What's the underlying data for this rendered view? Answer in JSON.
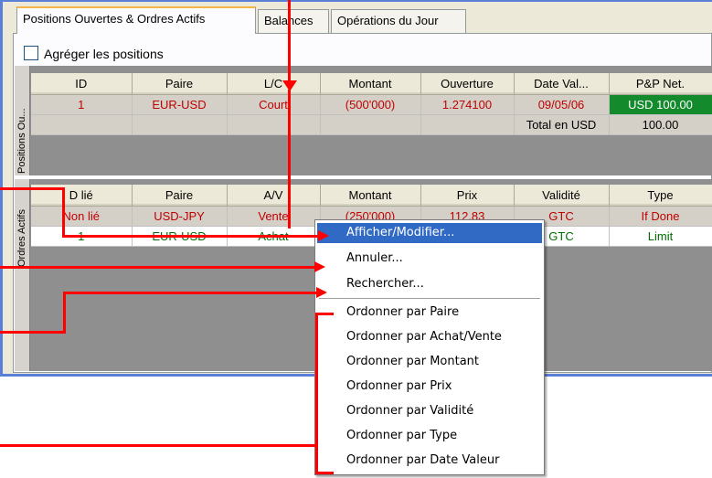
{
  "tabs": [
    {
      "label": "Positions Ouvertes & Ordres Actifs",
      "active": true
    },
    {
      "label": "Balances",
      "active": false
    },
    {
      "label": "Opérations du Jour",
      "active": false
    }
  ],
  "aggregate_label": "Agréger les positions",
  "positions": {
    "side_label": "Positions Ou...",
    "columns": [
      "ID",
      "Paire",
      "L/C",
      "Montant",
      "Ouverture",
      "Date Val...",
      "P&P Net."
    ],
    "row": [
      "1",
      "EUR-USD",
      "Court",
      "(500'000)",
      "1.274100",
      "09/05/06",
      "USD 100.00"
    ],
    "total_label": "Total en USD",
    "total_value": "100.00"
  },
  "orders": {
    "side_label": "Ordres Actifs",
    "columns": [
      "D lié",
      "Paire",
      "A/V",
      "Montant",
      "Prix",
      "Validité",
      "Type"
    ],
    "rows": [
      [
        "Non lié",
        "USD-JPY",
        "Vente",
        "(250'000)",
        "112.83",
        "GTC",
        "If Done"
      ],
      [
        "1",
        "EUR-USD",
        "Achat",
        "",
        "",
        "GTC",
        "Limit"
      ]
    ]
  },
  "context_menu": {
    "items": [
      "Afficher/Modifier...",
      "Annuler...",
      "Rechercher...",
      "Ordonner par Paire",
      "Ordonner par Achat/Vente",
      "Ordonner par Montant",
      "Ordonner par Prix",
      "Ordonner par Validité",
      "Ordonner par Type",
      "Ordonner par Date Valeur"
    ],
    "highlighted": "Afficher/Modifier..."
  },
  "colors": {
    "annotation": "#ff0000",
    "highlight": "#316ac5",
    "pnl_positive": "#138a2c",
    "short_text": "#c00000",
    "buy_text": "#007000"
  }
}
